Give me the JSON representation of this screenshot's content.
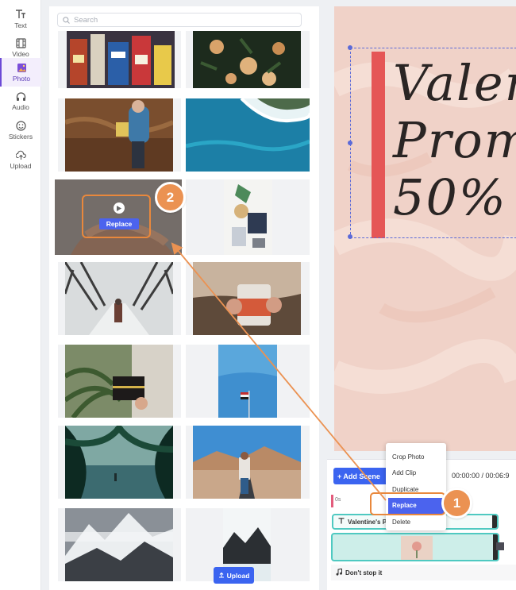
{
  "rail": {
    "items": [
      {
        "label": "Text",
        "icon": "text-icon",
        "active": false
      },
      {
        "label": "Video",
        "icon": "film-icon",
        "active": false
      },
      {
        "label": "Photo",
        "icon": "photo-icon",
        "active": true
      },
      {
        "label": "Audio",
        "icon": "headphones-icon",
        "active": false
      },
      {
        "label": "Stickers",
        "icon": "smiley-icon",
        "active": false
      },
      {
        "label": "Upload",
        "icon": "upload-icon",
        "active": false
      }
    ]
  },
  "gallery": {
    "search_placeholder": "Search",
    "hover_action_label": "Replace",
    "upload_label": "Upload"
  },
  "canvas": {
    "lines": [
      "Valen",
      "Prom",
      "50%"
    ],
    "accent_color": "#e55656",
    "background_color": "#f0d2c8"
  },
  "timeline": {
    "add_scene_label": "+ Add Scene",
    "time_readout": "00:00:00 / 00:06:9",
    "ruler_label": "0s",
    "text_track_label": "Valentine's P",
    "audio_track_label": "Don't stop it"
  },
  "context_menu": {
    "items": [
      "Crop Photo",
      "Add Clip",
      "Duplicate",
      "Replace",
      "Delete"
    ],
    "selected": "Replace"
  },
  "annotations": {
    "step1": "1",
    "step2": "2",
    "color": "#eb9252"
  }
}
